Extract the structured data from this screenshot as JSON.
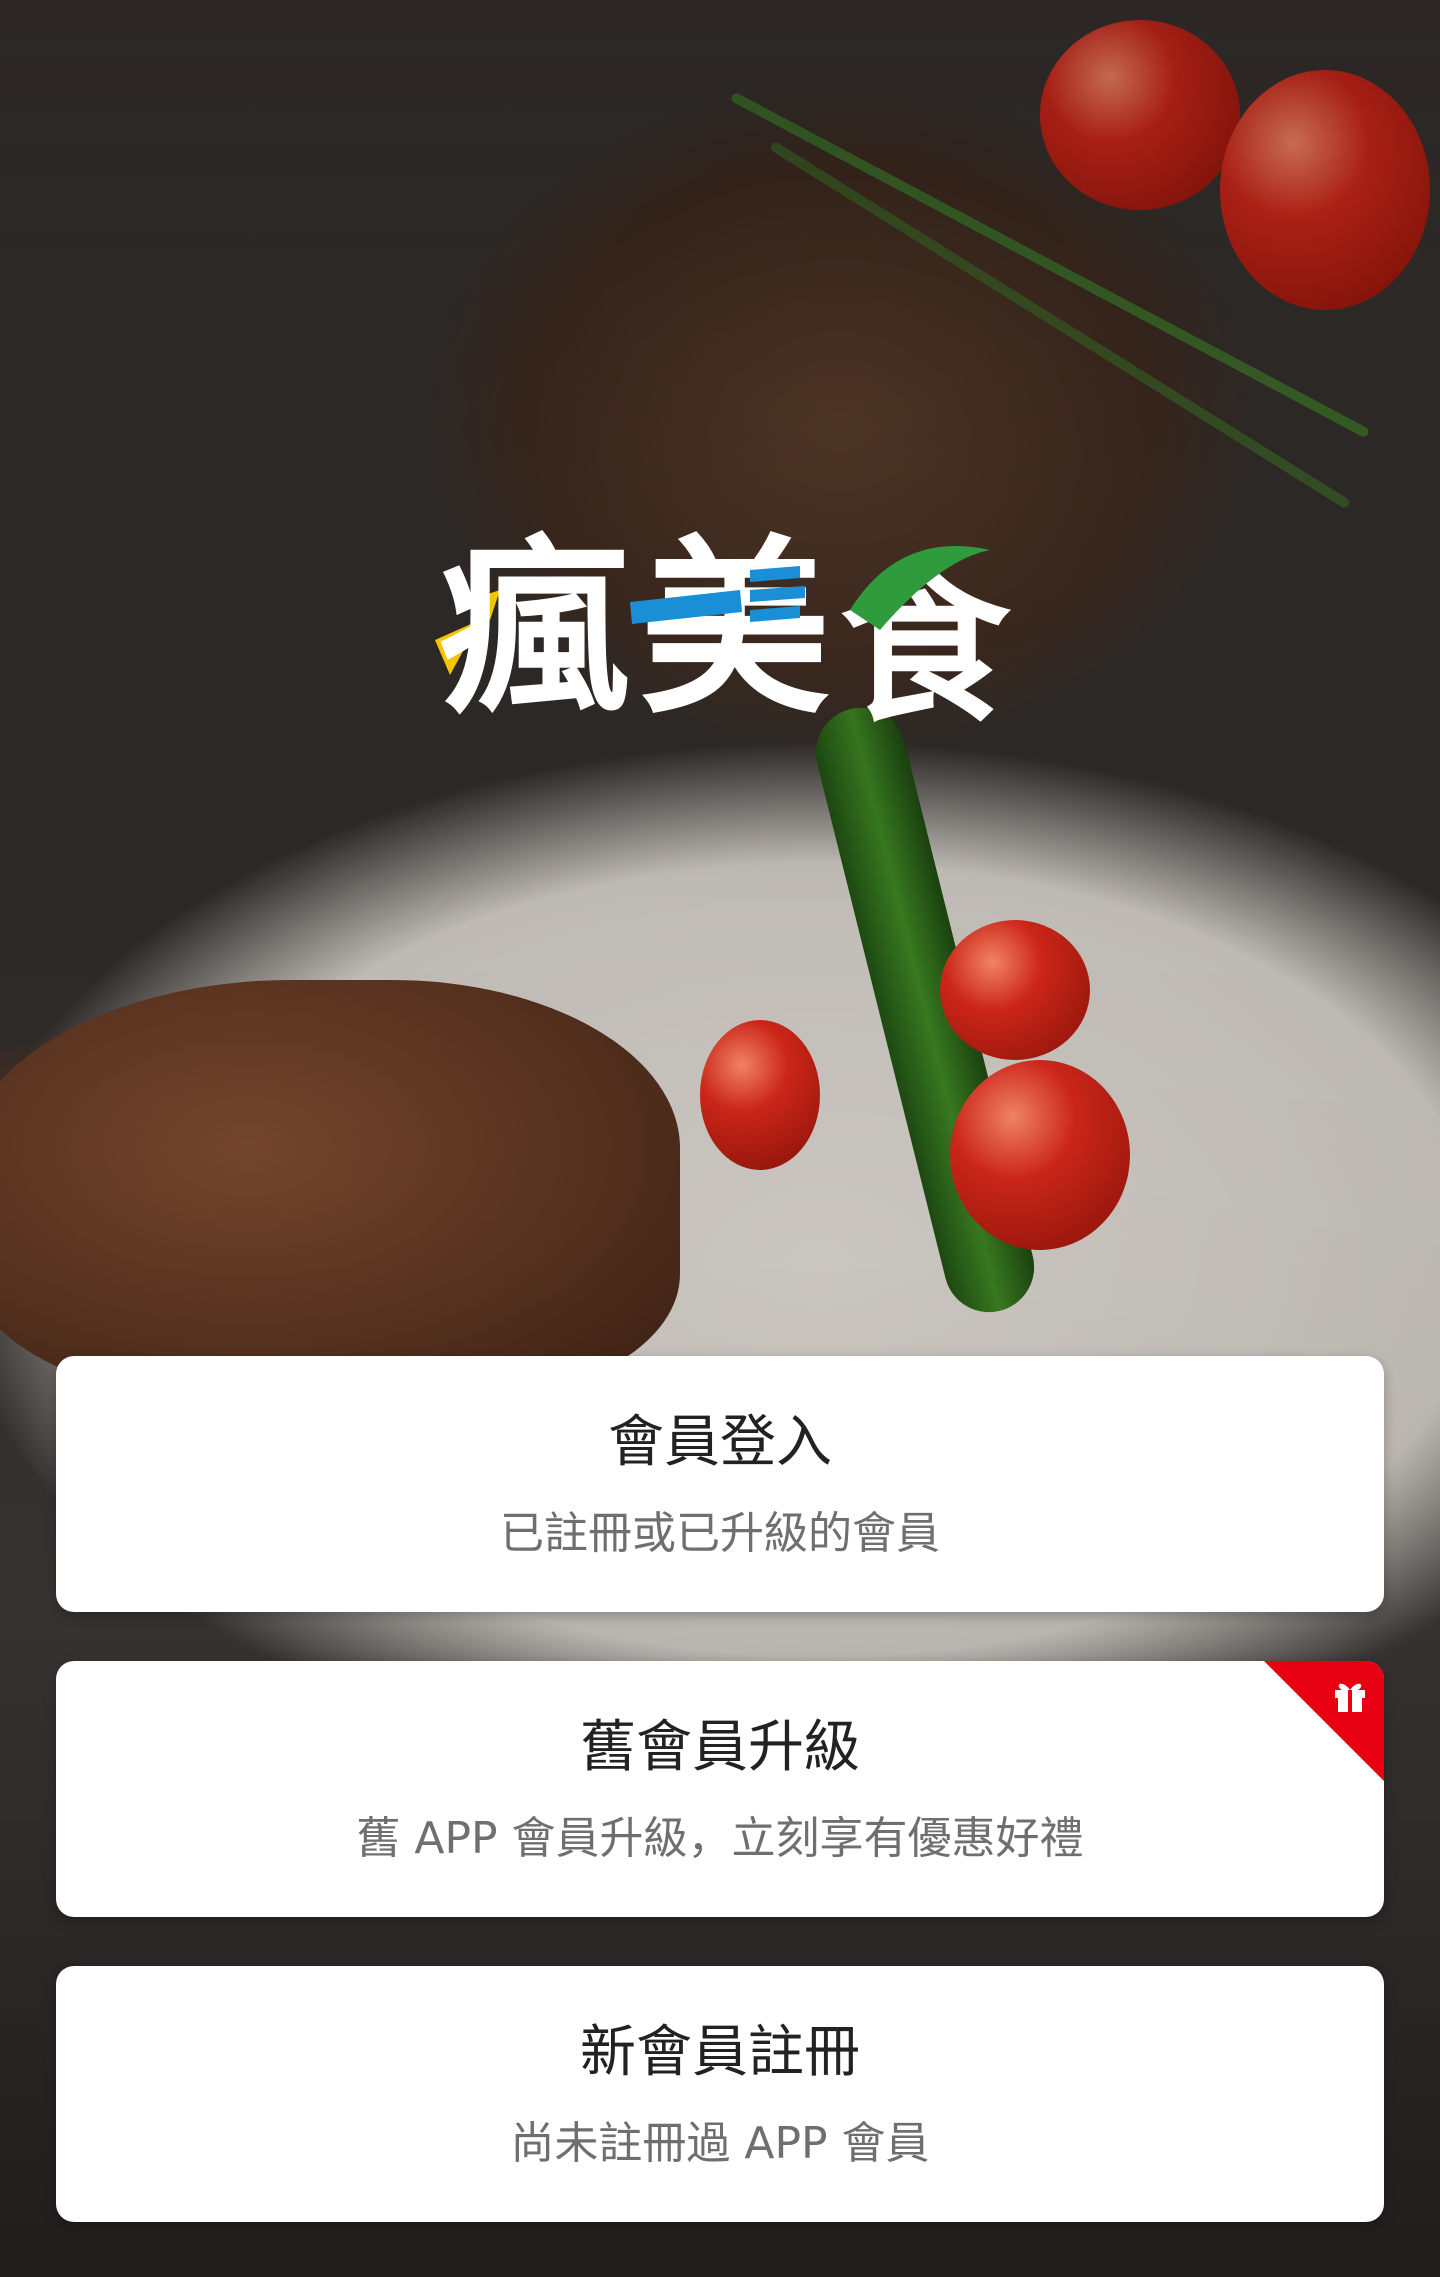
{
  "app": {
    "logo_text": "瘋美食",
    "logo_chars": [
      "瘋",
      "美",
      "食"
    ],
    "colors": {
      "logo_yellow": "#f5c400",
      "logo_blue": "#1a8fd6",
      "logo_green": "#2f9b3c",
      "ribbon_red": "#e60012"
    }
  },
  "options": [
    {
      "title": "會員登入",
      "subtitle": "已註冊或已升級的會員"
    },
    {
      "title": "舊會員升級",
      "subtitle": "舊 APP 會員升級，立刻享有優惠好禮",
      "badge_icon": "gift-icon"
    },
    {
      "title": "新會員註冊",
      "subtitle": "尚未註冊過 APP 會員"
    }
  ]
}
